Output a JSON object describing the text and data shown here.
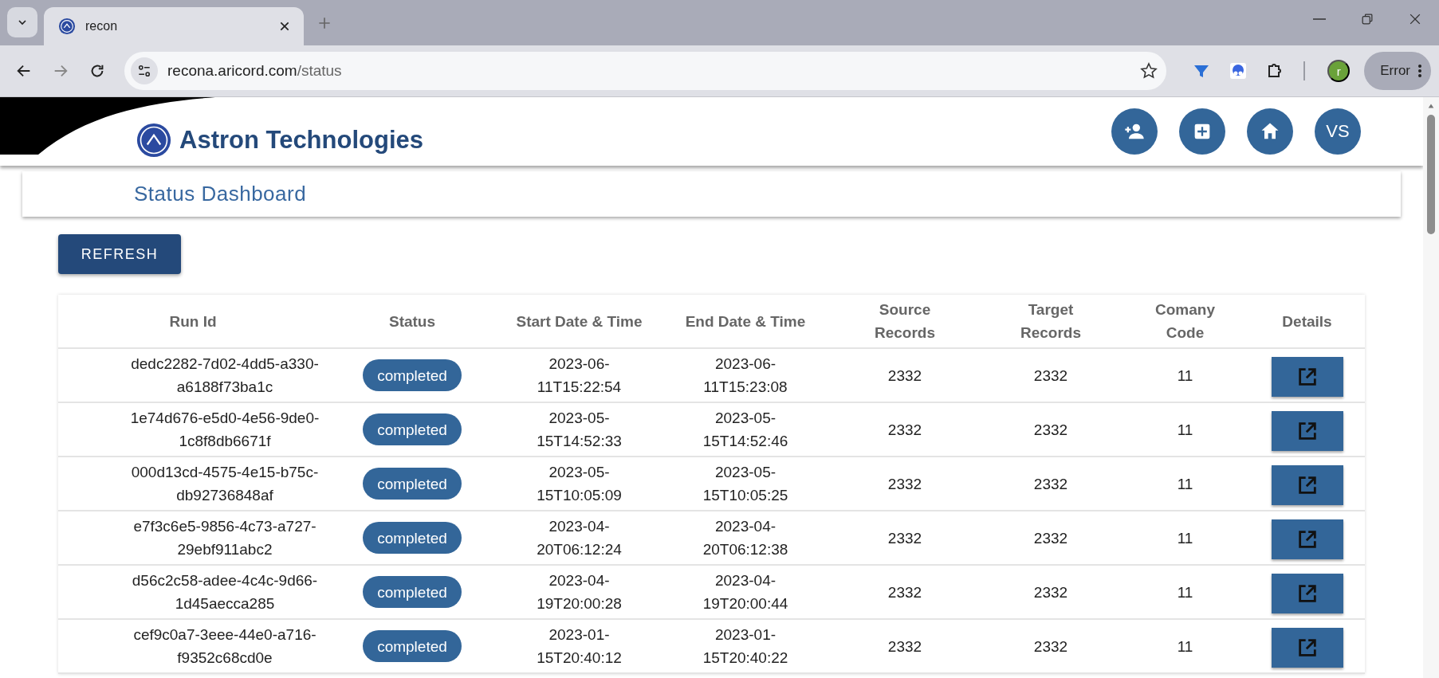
{
  "browser": {
    "tab_title": "recon",
    "url_host": "recona.aricord.com",
    "url_path": "/status",
    "profile_initial": "r",
    "error_label": "Error"
  },
  "app": {
    "title": "Astron Technologies",
    "avatar_initials": "VS"
  },
  "page_title": "Status Dashboard",
  "refresh_label": "REFRESH",
  "table": {
    "columns": [
      "Run Id",
      "Status",
      "Start Date & Time",
      "End Date & Time",
      "Source Records",
      "Target Records",
      "Comany Code",
      "Details"
    ],
    "rows": [
      {
        "run_id": "dedc2282-7d02-4dd5-a330-a6188f73ba1c",
        "status": "completed",
        "start": "2023-06-11T15:22:54",
        "end": "2023-06-11T15:23:08",
        "source": "2332",
        "target": "2332",
        "company_code": "11"
      },
      {
        "run_id": "1e74d676-e5d0-4e56-9de0-1c8f8db6671f",
        "status": "completed",
        "start": "2023-05-15T14:52:33",
        "end": "2023-05-15T14:52:46",
        "source": "2332",
        "target": "2332",
        "company_code": "11"
      },
      {
        "run_id": "000d13cd-4575-4e15-b75c-db92736848af",
        "status": "completed",
        "start": "2023-05-15T10:05:09",
        "end": "2023-05-15T10:05:25",
        "source": "2332",
        "target": "2332",
        "company_code": "11"
      },
      {
        "run_id": "e7f3c6e5-9856-4c73-a727-29ebf911abc2",
        "status": "completed",
        "start": "2023-04-20T06:12:24",
        "end": "2023-04-20T06:12:38",
        "source": "2332",
        "target": "2332",
        "company_code": "11"
      },
      {
        "run_id": "d56c2c58-adee-4c4c-9d66-1d45aecca285",
        "status": "completed",
        "start": "2023-04-19T20:00:28",
        "end": "2023-04-19T20:00:44",
        "source": "2332",
        "target": "2332",
        "company_code": "11"
      },
      {
        "run_id": "cef9c0a7-3eee-44e0-a716-f9352c68cd0e",
        "status": "completed",
        "start": "2023-01-15T20:40:12",
        "end": "2023-01-15T20:40:22",
        "source": "2332",
        "target": "2332",
        "company_code": "11"
      }
    ]
  }
}
